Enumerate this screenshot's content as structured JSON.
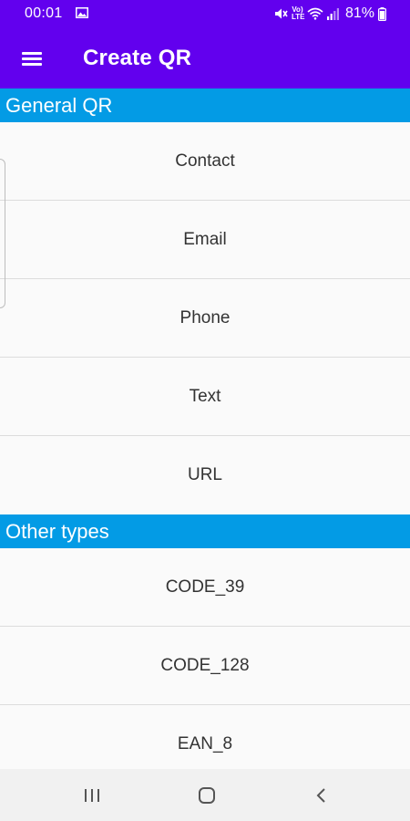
{
  "status_bar": {
    "time": "00:01",
    "volte": "Vo) LTE",
    "battery_percent": "81%"
  },
  "app_bar": {
    "title": "Create QR"
  },
  "sections": {
    "general": {
      "header": "General QR",
      "items": [
        "Contact",
        "Email",
        "Phone",
        "Text",
        "URL"
      ]
    },
    "other": {
      "header": "Other types",
      "items": [
        "CODE_39",
        "CODE_128",
        "EAN_8"
      ]
    }
  },
  "nav_bar": {
    "icons": [
      "recent-apps-icon",
      "home-icon",
      "back-icon"
    ]
  },
  "colors": {
    "app_bar": "#6200ee",
    "section_header": "#039be5",
    "background": "#fafafa",
    "nav_bar": "#f1f1f1"
  }
}
